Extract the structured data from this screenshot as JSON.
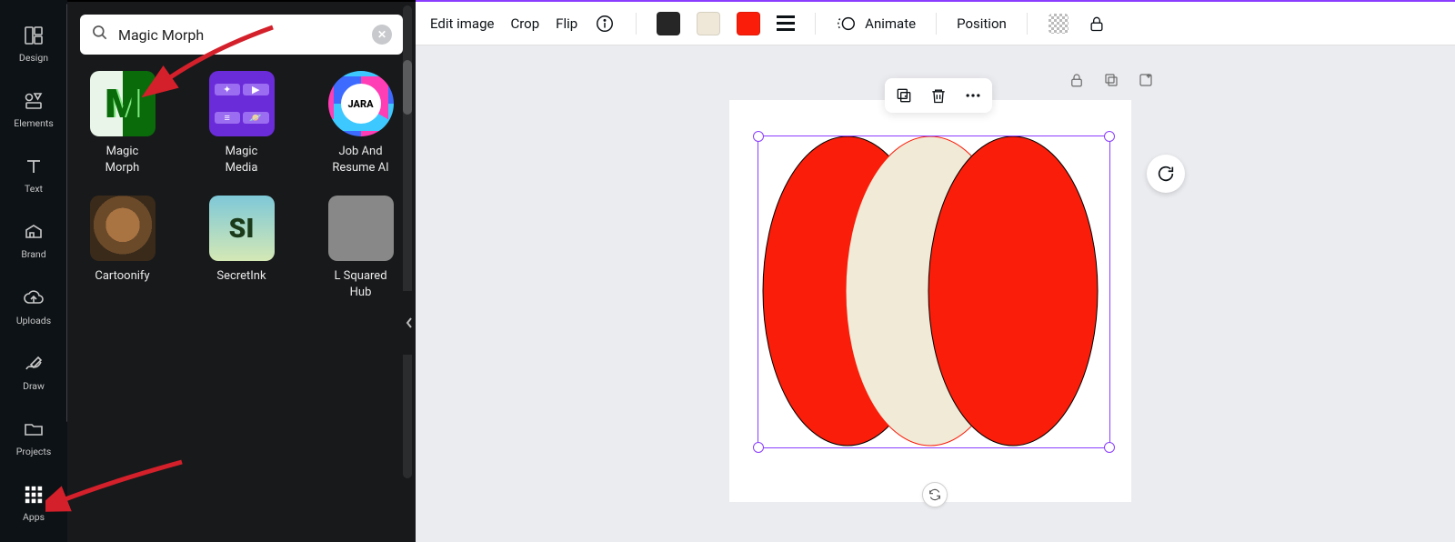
{
  "rail": {
    "items": [
      {
        "label": "Design"
      },
      {
        "label": "Elements"
      },
      {
        "label": "Text"
      },
      {
        "label": "Brand"
      },
      {
        "label": "Uploads"
      },
      {
        "label": "Draw"
      },
      {
        "label": "Projects"
      },
      {
        "label": "Apps"
      }
    ]
  },
  "search": {
    "value": "Magic Morph"
  },
  "apps": [
    {
      "label": "Magic\nMorph"
    },
    {
      "label": "Magic\nMedia"
    },
    {
      "label": "Job And\nResume AI"
    },
    {
      "label": "Cartoonify"
    },
    {
      "label": "SecretInk"
    },
    {
      "label": "L Squared\nHub"
    }
  ],
  "toolbar": {
    "edit_image": "Edit image",
    "crop": "Crop",
    "flip": "Flip",
    "animate": "Animate",
    "position": "Position",
    "colors": {
      "dark": "#262626",
      "cream": "#efe8d8",
      "red": "#f91d0a"
    }
  },
  "canvas": {
    "ovals": [
      {
        "fill": "#f91d0a",
        "stroke": "#000"
      },
      {
        "fill": "#f0ead6",
        "stroke": "#f91d0a"
      },
      {
        "fill": "#f91d0a",
        "stroke": "#000"
      }
    ],
    "selection_color": "#8b3dff"
  }
}
